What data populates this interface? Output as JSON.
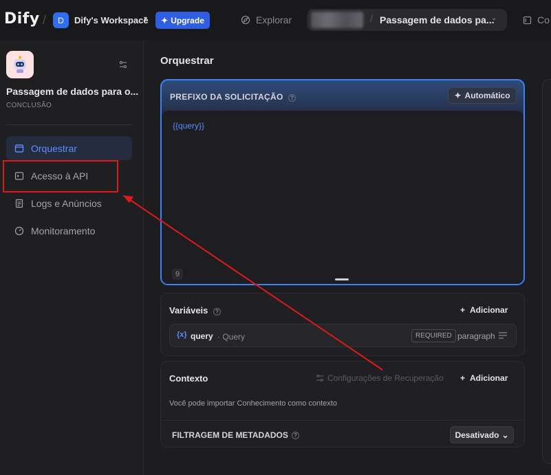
{
  "topbar": {
    "logo": "Dify",
    "workspace_initial": "D",
    "workspace_name": "Dify's Workspace",
    "upgrade_label": "Upgrade",
    "explore_label": "Explorar",
    "app_name": "Passagem de dados pa...",
    "right_label": "Co"
  },
  "sidebar": {
    "app_title": "Passagem de dados para o...",
    "app_mode": "CONCLUSÃO",
    "items": [
      {
        "label": "Orquestrar",
        "icon": "window-icon"
      },
      {
        "label": "Acesso à API",
        "icon": "terminal-icon"
      },
      {
        "label": "Logs e Anúncios",
        "icon": "document-icon"
      },
      {
        "label": "Monitoramento",
        "icon": "gauge-icon"
      }
    ]
  },
  "main": {
    "title": "Orquestrar",
    "prompt": {
      "header": "PREFIXO DA SOLICITAÇÃO",
      "auto_label": "Automático",
      "text": "{{query}}",
      "count": "9"
    },
    "variables": {
      "title": "Variáveis",
      "add_label": "Adicionar",
      "items": [
        {
          "icon": "{x}",
          "name": "query",
          "label": "· Query",
          "required": "REQUIRED",
          "type": "paragraph"
        }
      ]
    },
    "context": {
      "title": "Contexto",
      "retrieval_label": "Configurações de Recuperação",
      "add_label": "Adicionar",
      "description": "Você pode importar Conhecimento como contexto",
      "metadata_title": "FILTRAGEM DE METADADOS",
      "metadata_value": "Desativado"
    }
  },
  "colors": {
    "accent": "#5e8bff",
    "annotation": "#e11919"
  }
}
